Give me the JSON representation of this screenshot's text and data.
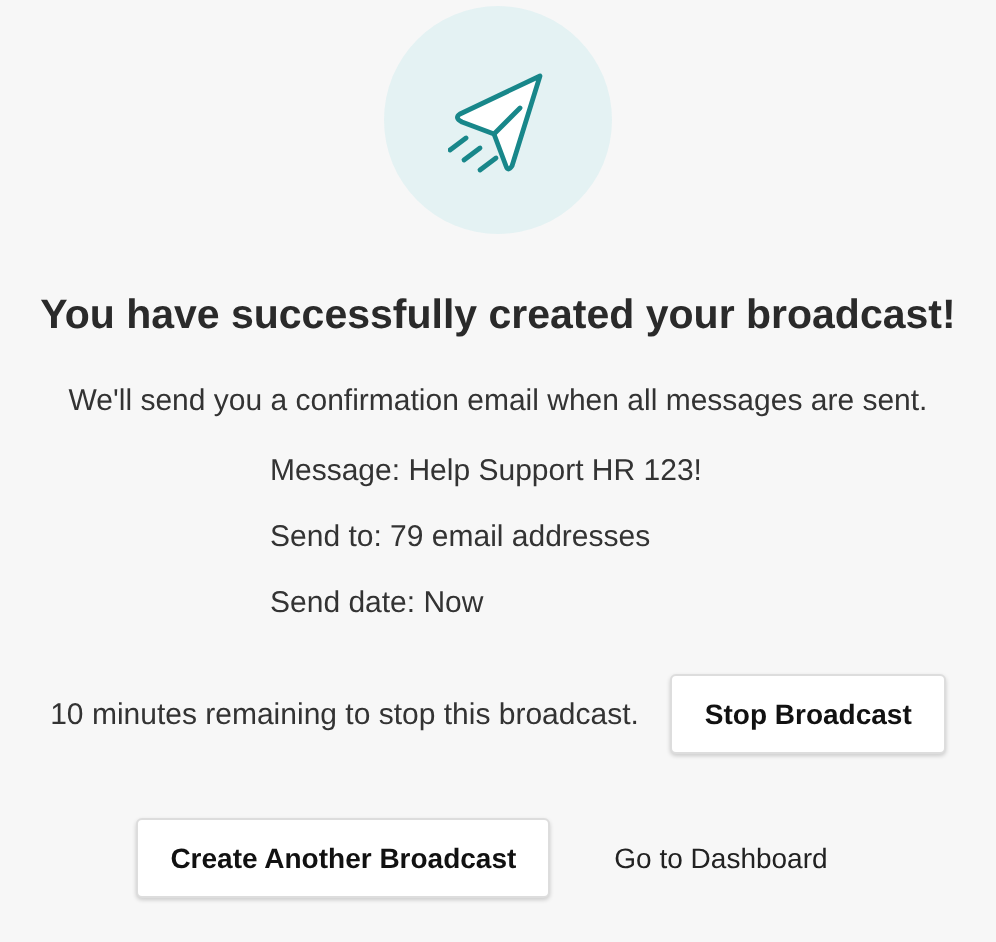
{
  "title": "You have successfully created your broadcast!",
  "subtitle": "We'll send you a confirmation email when all messages are sent.",
  "details": [
    "Message: Help Support HR 123!",
    "Send to: 79 email addresses",
    "Send date: Now"
  ],
  "stop_row": {
    "notice": "10 minutes remaining to stop this broadcast.",
    "button": "Stop Broadcast"
  },
  "actions": [
    {
      "kind": "button",
      "label": "Create Another Broadcast"
    },
    {
      "kind": "link",
      "label": "Go to Dashboard"
    }
  ]
}
